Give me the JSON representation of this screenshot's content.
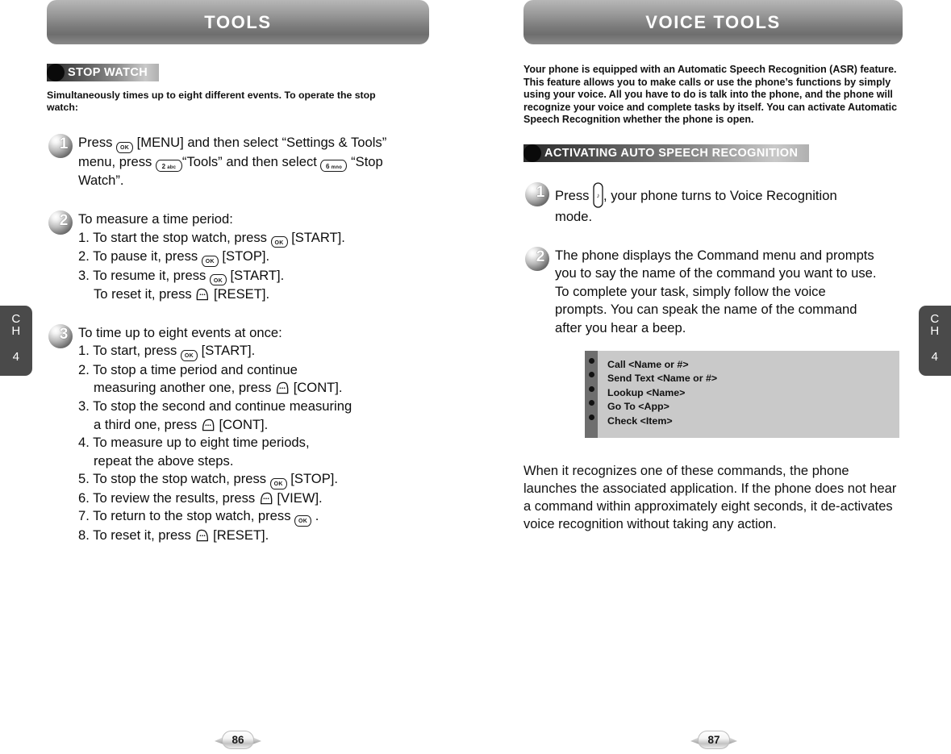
{
  "chapter_tab": {
    "ch_line1": "C",
    "ch_line2": "H",
    "number": "4"
  },
  "left_page": {
    "banner_title": "TOOLS",
    "section": {
      "title": "STOP WATCH"
    },
    "lead": "Simultaneously times up to eight different events. To operate the stop watch:",
    "steps": [
      {
        "number": "1",
        "lines": [
          "Press ",
          " [MENU] and then select “Settings & Tools” menu, press ",
          "“Tools” and then select ",
          " “Stop Watch”."
        ]
      },
      {
        "number": "2",
        "title": "To measure a time period:",
        "items": [
          {
            "text_before": "1. To start the stop watch, press ",
            "key": "OK",
            "text_after": " [START]."
          },
          {
            "text_before": "2. To pause it, press ",
            "key": "OK",
            "text_after": " [STOP]."
          },
          {
            "text_before": "3. To resume it, press ",
            "key": "OK",
            "text_after": " [START]."
          },
          {
            "text_before": "To reset it, press ",
            "key": "SOFT-RIGHT",
            "text_after": " [RESET]."
          }
        ]
      },
      {
        "number": "3",
        "title": "To time up to eight events at once:",
        "items": [
          {
            "text_before": "1. To start, press ",
            "key": "OK",
            "text_after": " [START]."
          },
          {
            "text_before": "2. To stop a time period and continue",
            "key": "",
            "text_after": ""
          },
          {
            "text_before": "measuring another one, press ",
            "key": "SOFT-LEFT",
            "text_after": " [CONT]."
          },
          {
            "text_before": "3. To stop the second and continue measuring",
            "key": "",
            "text_after": ""
          },
          {
            "text_before": "a third one, press ",
            "key": "SOFT-LEFT",
            "text_after": " [CONT]."
          },
          {
            "text_before": "4. To measure up to eight time periods,",
            "key": "",
            "text_after": ""
          },
          {
            "text_before": "repeat the above steps.",
            "key": "",
            "text_after": ""
          },
          {
            "text_before": "5. To stop the stop watch, press ",
            "key": "OK",
            "text_after": " [STOP]."
          },
          {
            "text_before": "6. To review the results, press ",
            "key": "SOFT-LEFT",
            "text_after": " [VIEW]."
          },
          {
            "text_before": "7. To return to the stop watch, press ",
            "key": "OK",
            "text_after": " ."
          },
          {
            "text_before": "8. To reset it, press ",
            "key": "SOFT-RIGHT",
            "text_after": " [RESET]."
          }
        ]
      }
    ],
    "page_number": "86"
  },
  "right_page": {
    "banner_title": "VOICE TOOLS",
    "intro": "Your phone is equipped with an Automatic Speech Recognition (ASR) feature. This feature allows you to make calls or use the phone’s functions by simply using your voice. All you have to do is talk into the phone, and the phone will recognize your voice and complete tasks by itself. You can activate Automatic Speech Recognition whether the phone is open.",
    "section": {
      "title": "ACTIVATING AUTO SPEECH RECOGNITION"
    },
    "steps": [
      {
        "number": "1",
        "text_before": "Press ",
        "text_after": ", your phone turns to Voice Recognition mode."
      },
      {
        "number": "2",
        "text": "The phone displays the Command menu and prompts you to say the name of the command you want to use. To complete your task, simply follow the voice prompts. You can speak the name of the command after you hear a beep."
      }
    ],
    "command_box": {
      "items": [
        "Call <Name or #>",
        "Send Text <Name or #>",
        "Lookup <Name>",
        "Go To <App>",
        "Check <Item>"
      ]
    },
    "closing": "When it recognizes one of these commands, the phone launches the associated application. If the phone does not hear a command within approximately eight seconds, it de-activates voice recognition without taking any action.",
    "page_number": "87"
  },
  "key_glyphs": {
    "ok_label": "OK",
    "key2_digit": "2",
    "key2_letters": "abc",
    "key6_digit": "6",
    "key6_letters": "mno"
  },
  "colors": {
    "banner_dark": "#6e6e6e",
    "banner_light": "#b7b7b7",
    "tab_bg": "#4a4a4a",
    "cmdbox_bg": "#c9c9c9",
    "cmdbox_rail": "#6e6e6e",
    "text": "#111111"
  }
}
